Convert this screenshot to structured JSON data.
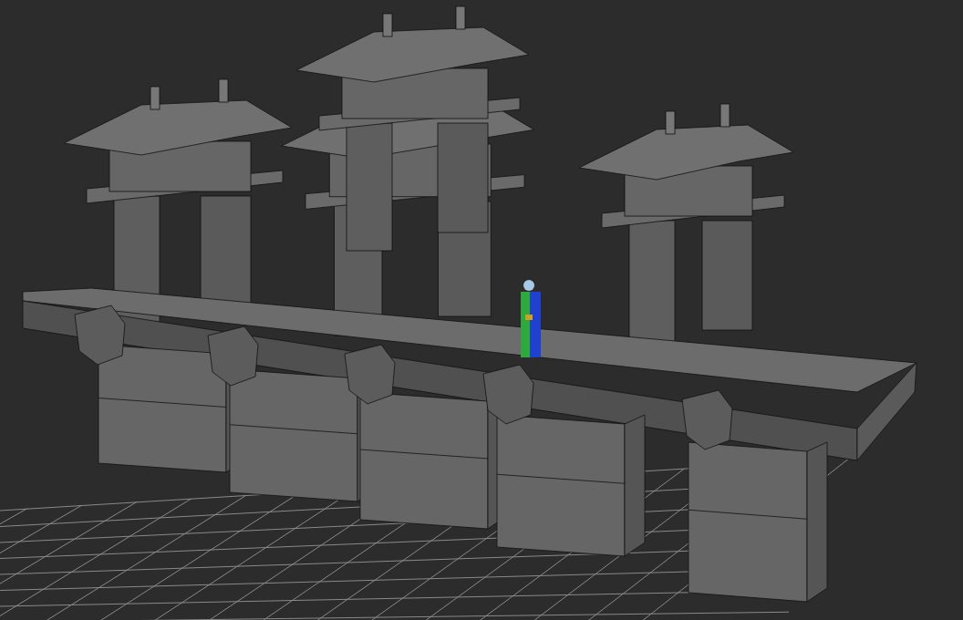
{
  "viewport": {
    "grid_visible": true
  }
}
